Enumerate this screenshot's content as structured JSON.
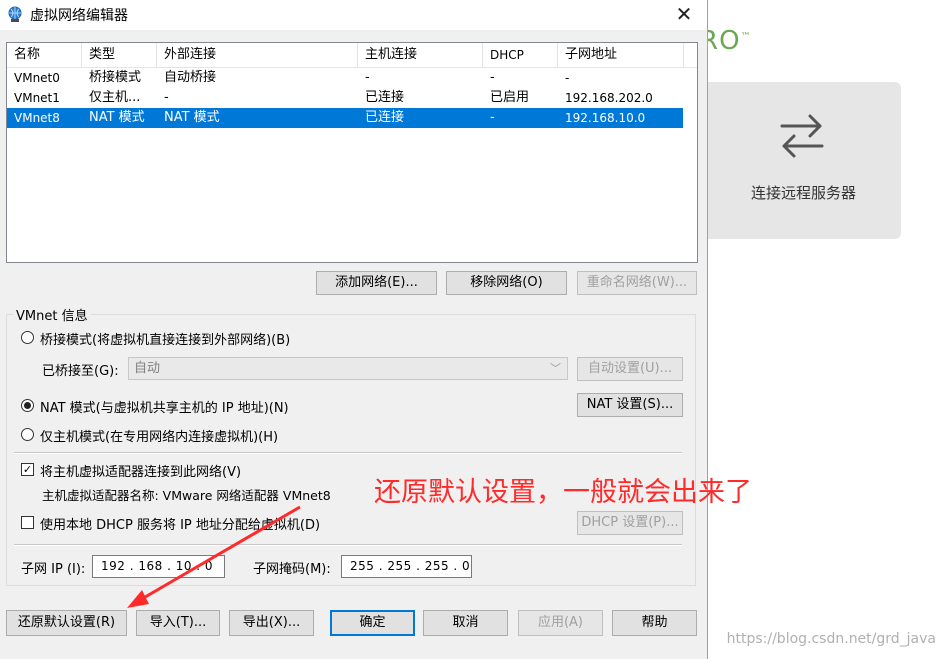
{
  "window": {
    "title": "虚拟网络编辑器",
    "close": "✕"
  },
  "network_table": {
    "columns": [
      "名称",
      "类型",
      "外部连接",
      "主机连接",
      "DHCP",
      "子网地址"
    ],
    "rows": [
      [
        "VMnet0",
        "桥接模式",
        "自动桥接",
        "-",
        "-",
        "-"
      ],
      [
        "VMnet1",
        "仅主机...",
        "-",
        "已连接",
        "已启用",
        "192.168.202.0"
      ],
      [
        "VMnet8",
        "NAT 模式",
        "NAT 模式",
        "已连接",
        "-",
        "192.168.10.0"
      ]
    ],
    "selected_row": 2
  },
  "list_buttons": {
    "add": "添加网络(E)...",
    "remove": "移除网络(O)",
    "rename": "重命名网络(W)..."
  },
  "vmnet_info": {
    "group_label": "VMnet 信息",
    "bridge_mode": "桥接模式(将虚拟机直接连接到外部网络)(B)",
    "bridged_to_label": "已桥接至(G):",
    "bridged_to_value": "自动",
    "auto_settings": "自动设置(U)...",
    "nat_mode": "NAT 模式(与虚拟机共享主机的 IP 地址)(N)",
    "nat_settings": "NAT 设置(S)...",
    "host_only": "仅主机模式(在专用网络内连接虚拟机)(H)",
    "connect_adapter": "将主机虚拟适配器连接到此网络(V)",
    "adapter_name": "主机虚拟适配器名称: VMware 网络适配器 VMnet8",
    "use_dhcp": "使用本地 DHCP 服务将 IP 地址分配给虚拟机(D)",
    "dhcp_settings": "DHCP 设置(P)...",
    "subnet_ip_label": "子网 IP (I):",
    "subnet_ip_value": "192 . 168 . 10 .  0",
    "subnet_mask_label": "子网掩码(M):",
    "subnet_mask_value": "255 . 255 . 255 .  0",
    "selected_mode": "nat",
    "connect_adapter_checked": true,
    "use_dhcp_checked": false
  },
  "bottom_buttons": {
    "restore": "还原默认设置(R)",
    "import": "导入(T)...",
    "export": "导出(X)...",
    "ok": "确定",
    "cancel": "取消",
    "apply": "应用(A)",
    "help": "帮助"
  },
  "annotation": {
    "text": "还原默认设置，一般就会出来了",
    "color": "#ff2a2a"
  },
  "background_app": {
    "logo_text": "RO",
    "logo_mark": "™",
    "card_label": "连接远程服务器",
    "card_icon": "swap-arrows-icon"
  },
  "watermark": "https://blog.csdn.net/grd_java"
}
